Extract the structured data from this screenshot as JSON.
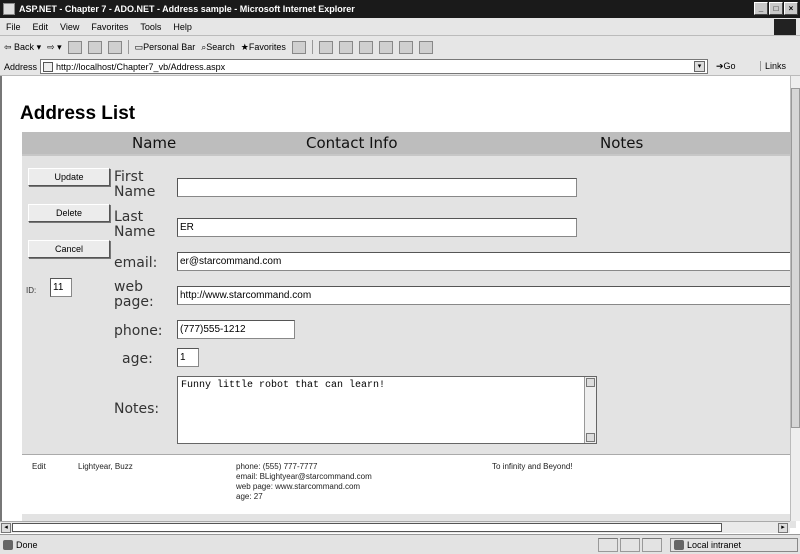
{
  "window": {
    "title": "ASP.NET - Chapter 7 - ADO.NET - Address sample - Microsoft Internet Explorer",
    "controls": [
      "_",
      "□",
      "×"
    ]
  },
  "menu": [
    "File",
    "Edit",
    "View",
    "Favorites",
    "Tools",
    "Help"
  ],
  "toolbar": {
    "back_label": "Back",
    "personal_bar_label": "Personal Bar",
    "search_label": "Search",
    "favorites_label": "Favorites",
    "address_label": "Address",
    "address_url": "http://localhost/Chapter7_vb/Address.aspx",
    "go_label": "Go",
    "links_label": "Links"
  },
  "page": {
    "title": "Address List",
    "columns": [
      "Name",
      "Contact Info",
      "Notes"
    ]
  },
  "edit_form": {
    "buttons": {
      "update": "Update",
      "delete": "Delete",
      "cancel": "Cancel"
    },
    "id_label": "ID:",
    "id_value": "11",
    "labels": {
      "first_name": "First Name",
      "last_name": "Last Name",
      "email": "email:",
      "web_page": "web page:",
      "phone": "phone:",
      "age": "age:",
      "notes": "Notes:"
    },
    "values": {
      "first_name": "",
      "last_name": "ER",
      "email": "er@starcommand.com",
      "web_page": "http://www.starcommand.com",
      "phone": "(777)555-1212",
      "age": "1",
      "notes": "Funny little robot that can learn!"
    }
  },
  "record": {
    "edit_link": "Edit",
    "name": "Lightyear, Buzz",
    "contact_lines": [
      "phone: (555) 777-7777",
      "email: BLightyear@starcommand.com",
      "web page: www.starcommand.com",
      "age: 27"
    ],
    "notes": "To infinity and Beyond!"
  },
  "status": {
    "text": "Done",
    "zone": "Local intranet"
  }
}
